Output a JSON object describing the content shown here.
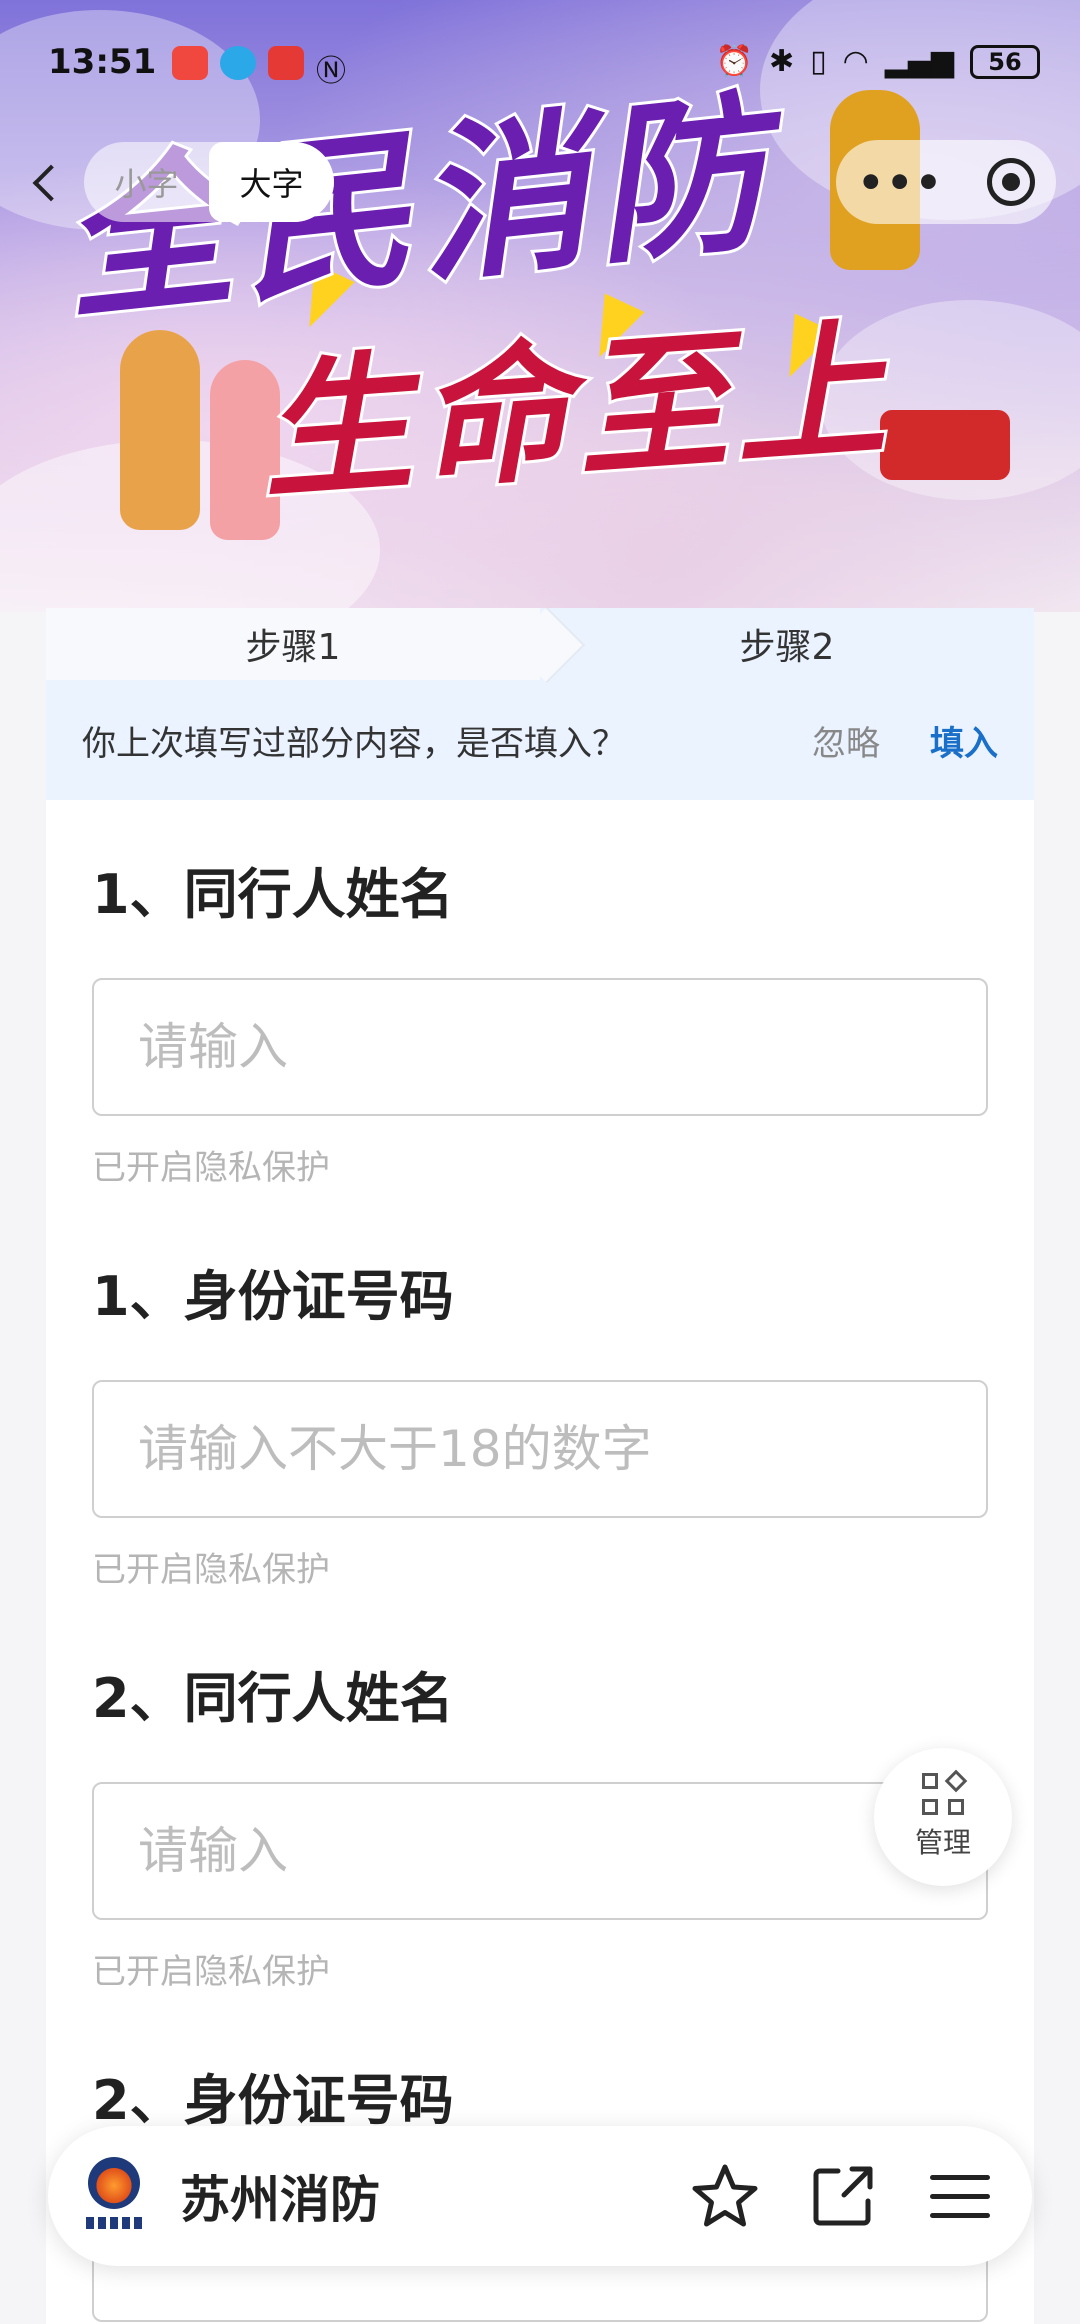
{
  "status_bar": {
    "time": "13:51",
    "battery": "56"
  },
  "topbar": {
    "small_text": "小字",
    "large_text": "大字"
  },
  "banner": {
    "line1": "全民消防",
    "line2": "生命至上"
  },
  "steps": [
    {
      "label": "步骤1"
    },
    {
      "label": "步骤2"
    }
  ],
  "prompt": {
    "message": "你上次填写过部分内容，是否填入？",
    "ignore": "忽略",
    "fill": "填入"
  },
  "questions": [
    {
      "title": "1、同行人姓名",
      "placeholder": "请输入",
      "note": "已开启隐私保护"
    },
    {
      "title": "1、身份证号码",
      "placeholder": "请输入不大于18的数字",
      "note": "已开启隐私保护"
    },
    {
      "title": "2、同行人姓名",
      "placeholder": "请输入",
      "note": "已开启隐私保护"
    },
    {
      "title": "2、身份证号码",
      "placeholder": "",
      "note": ""
    }
  ],
  "manage": {
    "label": "管理"
  },
  "bottom_bar": {
    "app_name": "苏州消防"
  },
  "colors": {
    "accent": "#1a6fc9",
    "prompt_bg": "#eaf3ff",
    "banner_purple": "#6a1fb0",
    "banner_red": "#c8143c"
  },
  "icons": [
    "back-icon",
    "more-icon",
    "target-icon",
    "manage-icon",
    "star-icon",
    "share-icon",
    "menu-icon"
  ]
}
